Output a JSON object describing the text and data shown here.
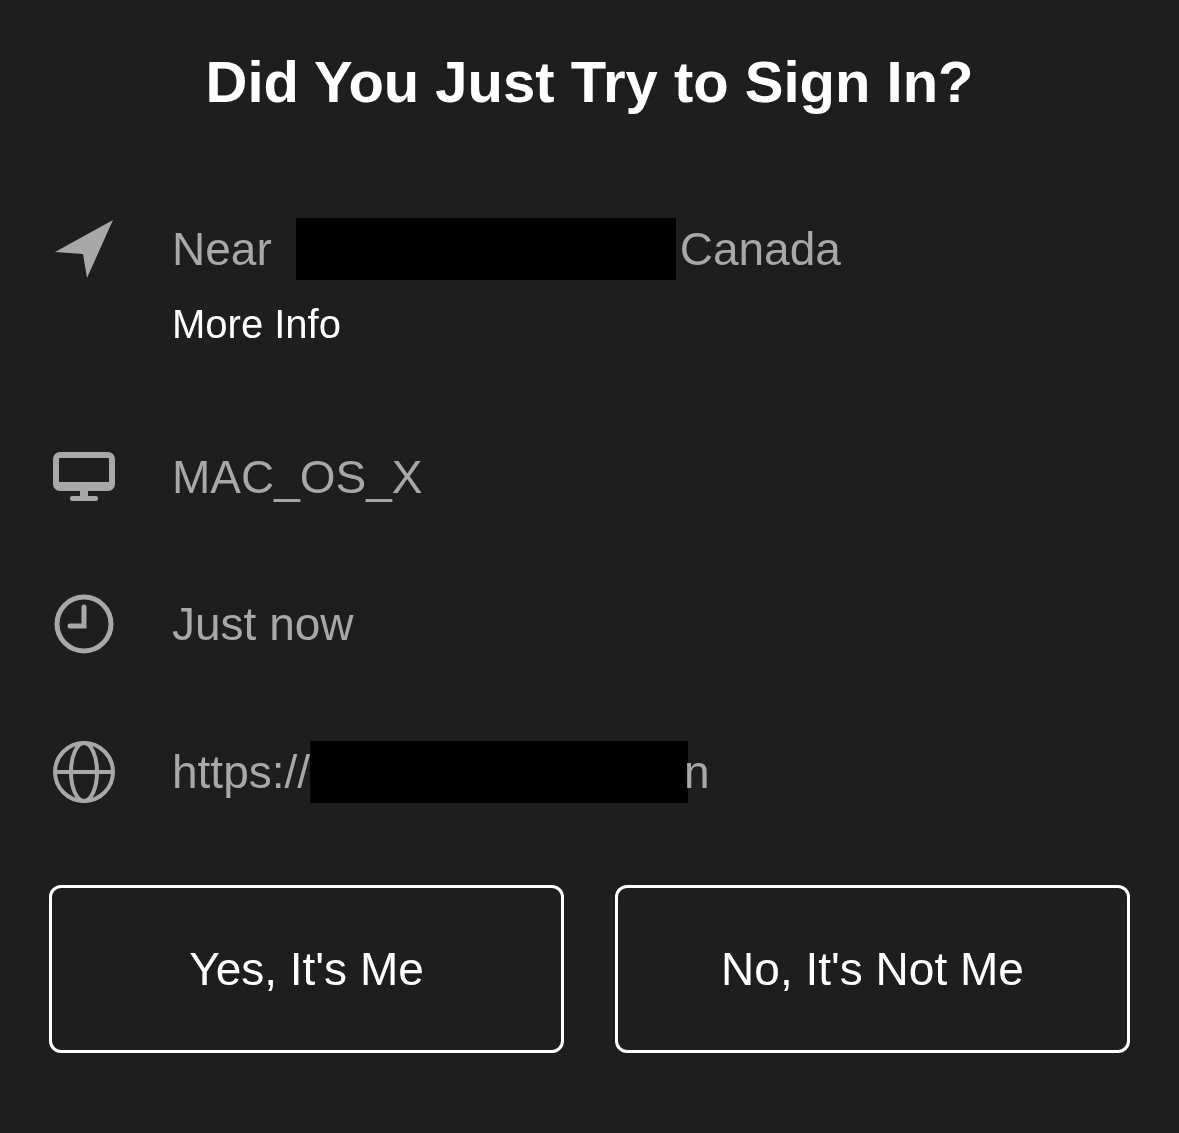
{
  "title": "Did You Just Try to Sign In?",
  "details": [
    {
      "kind": "location",
      "parts": [
        {
          "kind": "text",
          "text": "Near"
        },
        {
          "kind": "redaction"
        },
        {
          "kind": "text",
          "text": "Canada"
        }
      ],
      "link": "More Info"
    },
    {
      "kind": "device",
      "parts": [
        {
          "kind": "text",
          "text": "MAC_OS_X"
        }
      ]
    },
    {
      "kind": "time",
      "parts": [
        {
          "kind": "text",
          "text": "Just now"
        }
      ]
    },
    {
      "kind": "website",
      "parts": [
        {
          "kind": "text",
          "text": "https://"
        },
        {
          "kind": "redaction"
        },
        {
          "kind": "text",
          "text": "n"
        }
      ]
    }
  ],
  "buttons": [
    "Yes, It's Me",
    "No, It's Not Me"
  ]
}
